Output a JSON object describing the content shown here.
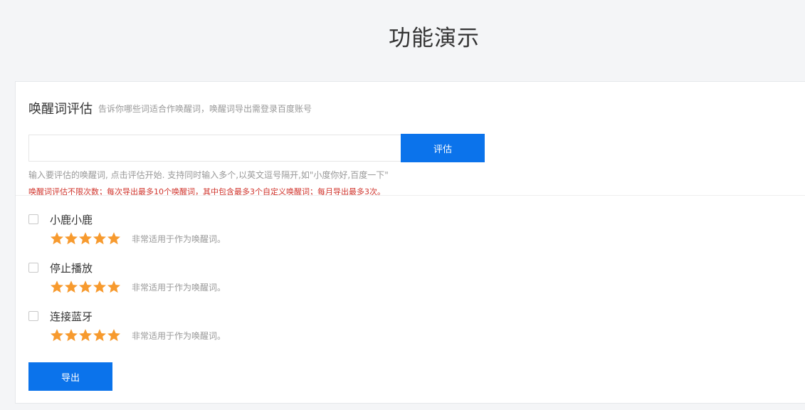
{
  "page": {
    "title": "功能演示"
  },
  "section": {
    "title": "唤醒词评估",
    "description": "告诉你哪些词适合作唤醒词，唤醒词导出需登录百度账号"
  },
  "input": {
    "value": "",
    "placeholder": ""
  },
  "buttons": {
    "evaluate_label": "评估",
    "export_label": "导出"
  },
  "hint": "输入要评估的唤醒词, 点击评估开始. 支持同时输入多个,以英文逗号隔开,如\"小度你好,百度一下\"",
  "limit_notice": "唤醒词评估不限次数；每次导出最多10个唤醒词，其中包含最多3个自定义唤醒词；每月导出最多3次。",
  "colors": {
    "accent": "#0b73eb",
    "star": "#f79a2e",
    "warning": "#d0342c"
  },
  "results": [
    {
      "word": "小鹿小鹿",
      "rating": 5,
      "max_rating": 5,
      "description": "非常适用于作为唤醒词。",
      "checked": false
    },
    {
      "word": "停止播放",
      "rating": 5,
      "max_rating": 5,
      "description": "非常适用于作为唤醒词。",
      "checked": false
    },
    {
      "word": "连接蓝牙",
      "rating": 5,
      "max_rating": 5,
      "description": "非常适用于作为唤醒词。",
      "checked": false
    }
  ]
}
